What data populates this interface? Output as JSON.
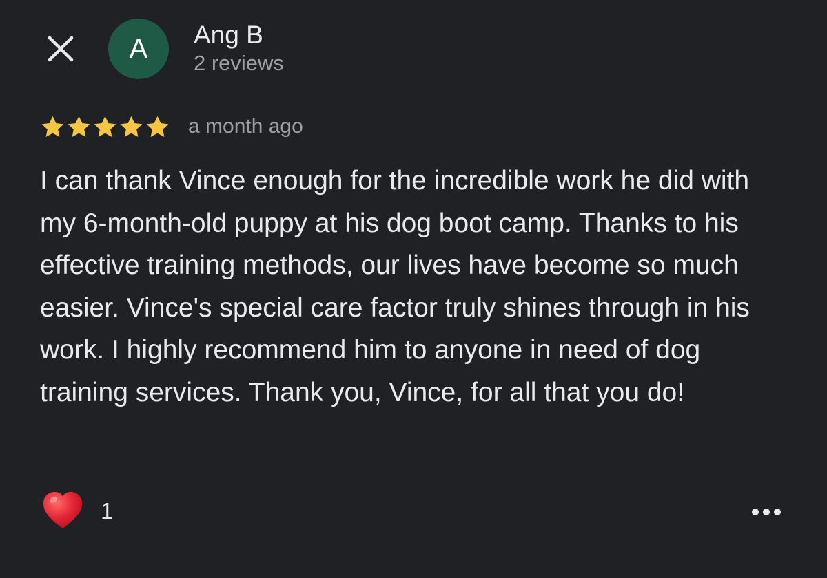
{
  "colors": {
    "background": "#202124",
    "avatar_bg": "#1f5a46",
    "star": "#f6c642",
    "heart": "#e32636",
    "primary_text": "#e8eaed",
    "secondary_text": "#9aa0a6"
  },
  "header": {
    "close_icon": "close-icon",
    "avatar_letter": "A",
    "author_name": "Ang B",
    "review_count": "2 reviews"
  },
  "review": {
    "rating": 5,
    "rating_max": 5,
    "timestamp": "a month ago",
    "text": "I can thank Vince enough for the incredible work he did with my 6-month-old puppy at his dog boot camp. Thanks to his effective training methods, our lives have become so much easier. Vince's special care factor truly shines through in his work. I highly recommend him to anyone in need of dog training services. Thank you, Vince, for all that you do!"
  },
  "reactions": {
    "icon": "heart-icon",
    "count": "1"
  },
  "more_menu": {
    "icon": "more-horizontal-icon"
  }
}
